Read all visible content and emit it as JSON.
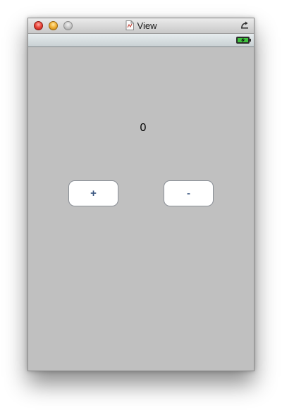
{
  "window": {
    "title": "View"
  },
  "main": {
    "counter_value": "0",
    "increment_label": "+",
    "decrement_label": "-"
  },
  "icons": {
    "document": "document-icon",
    "rotate": "rotate-icon",
    "battery": "battery-charging-icon"
  },
  "colors": {
    "background": "#c0c0c0",
    "button_text": "#3a5680",
    "button_fill": "#ffffff"
  }
}
